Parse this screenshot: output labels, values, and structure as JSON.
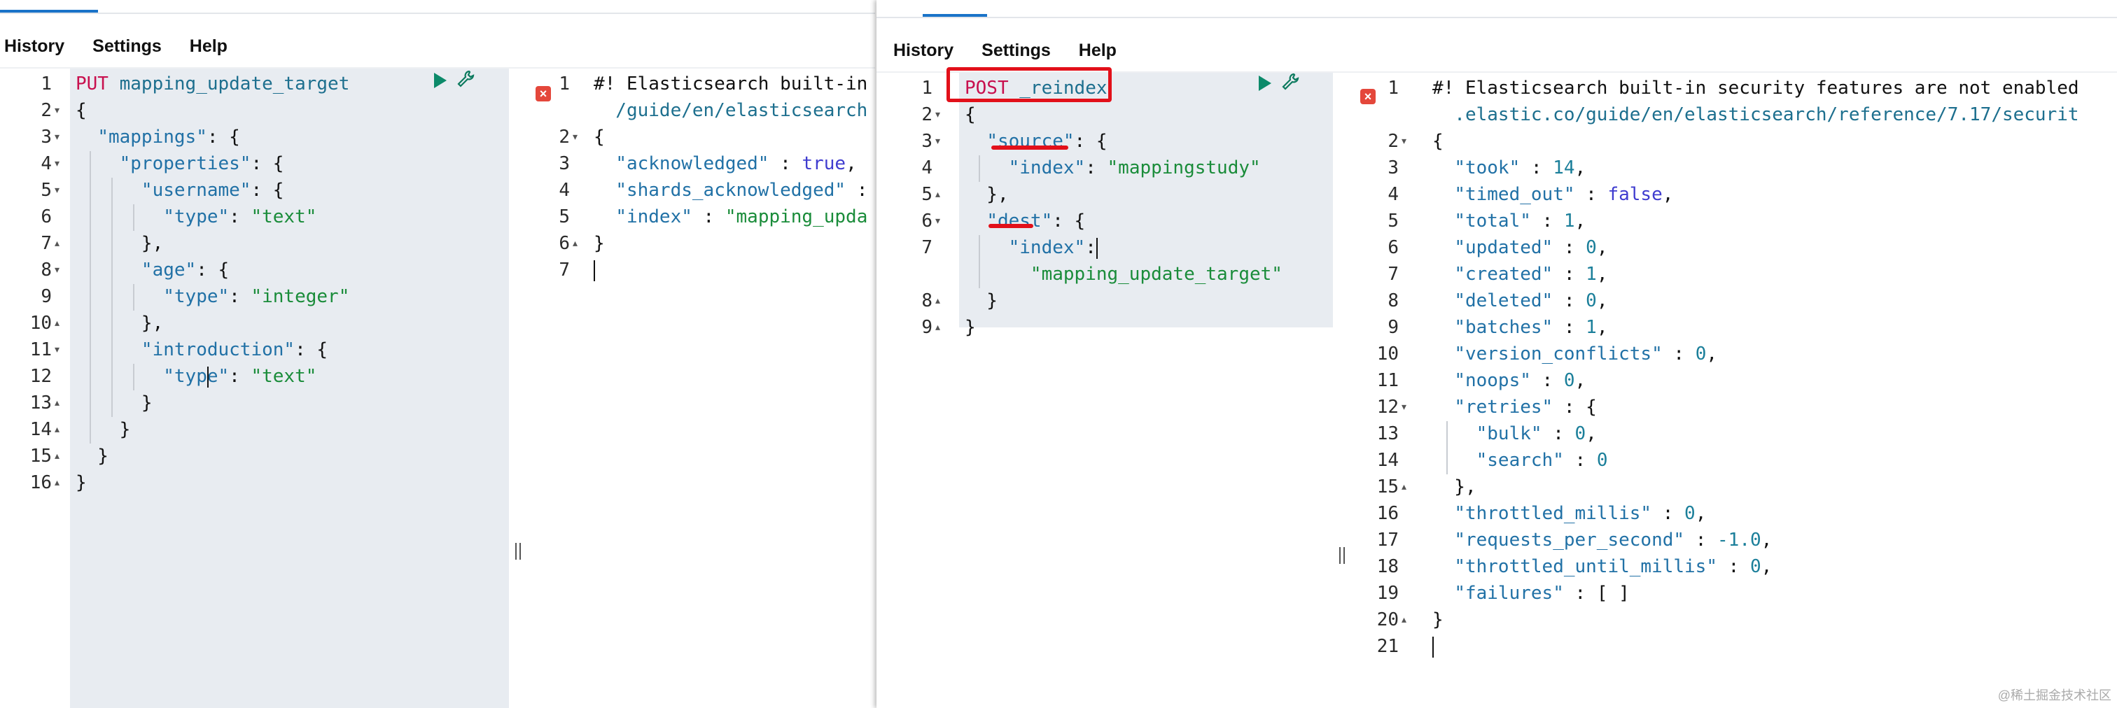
{
  "left_console": {
    "menu": [
      "History",
      "Settings",
      "Help"
    ],
    "request_lines": [
      [
        {
          "t": "PUT",
          "c": "m"
        },
        {
          "t": " mapping_update_target",
          "c": "p"
        }
      ],
      [
        {
          "t": "{",
          "c": "c"
        }
      ],
      [
        {
          "t": "  ",
          "c": "c"
        },
        {
          "t": "\"mappings\"",
          "c": "k"
        },
        {
          "t": ": {",
          "c": "c"
        }
      ],
      [
        {
          "t": "    ",
          "c": "c"
        },
        {
          "t": "\"properties\"",
          "c": "k"
        },
        {
          "t": ": {",
          "c": "c"
        }
      ],
      [
        {
          "t": "      ",
          "c": "c"
        },
        {
          "t": "\"username\"",
          "c": "k"
        },
        {
          "t": ": {",
          "c": "c"
        }
      ],
      [
        {
          "t": "        ",
          "c": "c"
        },
        {
          "t": "\"type\"",
          "c": "k"
        },
        {
          "t": ": ",
          "c": "c"
        },
        {
          "t": "\"text\"",
          "c": "s"
        }
      ],
      [
        {
          "t": "      },",
          "c": "c"
        }
      ],
      [
        {
          "t": "      ",
          "c": "c"
        },
        {
          "t": "\"age\"",
          "c": "k"
        },
        {
          "t": ": {",
          "c": "c"
        }
      ],
      [
        {
          "t": "        ",
          "c": "c"
        },
        {
          "t": "\"type\"",
          "c": "k"
        },
        {
          "t": ": ",
          "c": "c"
        },
        {
          "t": "\"integer\"",
          "c": "s"
        }
      ],
      [
        {
          "t": "      },",
          "c": "c"
        }
      ],
      [
        {
          "t": "      ",
          "c": "c"
        },
        {
          "t": "\"introduction\"",
          "c": "k"
        },
        {
          "t": ": {",
          "c": "c"
        }
      ],
      [
        {
          "t": "        ",
          "c": "c"
        },
        {
          "t": "\"type\"",
          "c": "k"
        },
        {
          "t": ": ",
          "c": "c"
        },
        {
          "t": "\"text\"",
          "c": "s"
        }
      ],
      [
        {
          "t": "      }",
          "c": "c"
        }
      ],
      [
        {
          "t": "    }",
          "c": "c"
        }
      ],
      [
        {
          "t": "  }",
          "c": "c"
        }
      ],
      [
        {
          "t": "}",
          "c": "c"
        }
      ]
    ],
    "response_lines": [
      [
        {
          "t": "#! Elasticsearch built-in",
          "c": "c"
        }
      ],
      [
        {
          "t": "  /guide/en/elasticsearch",
          "c": "p"
        }
      ],
      [
        {
          "t": "{",
          "c": "c"
        }
      ],
      [
        {
          "t": "  ",
          "c": "c"
        },
        {
          "t": "\"acknowledged\"",
          "c": "k"
        },
        {
          "t": " : ",
          "c": "c"
        },
        {
          "t": "true",
          "c": "b"
        },
        {
          "t": ",",
          "c": "c"
        }
      ],
      [
        {
          "t": "  ",
          "c": "c"
        },
        {
          "t": "\"shards_acknowledged\"",
          "c": "k"
        },
        {
          "t": " :",
          "c": "c"
        }
      ],
      [
        {
          "t": "  ",
          "c": "c"
        },
        {
          "t": "\"index\"",
          "c": "k"
        },
        {
          "t": " : ",
          "c": "c"
        },
        {
          "t": "\"mapping_upda",
          "c": "s"
        }
      ],
      [
        {
          "t": "}",
          "c": "c"
        }
      ],
      [
        {
          "t": "",
          "c": "c"
        }
      ]
    ],
    "response_line_numbers": [
      "1",
      "",
      "2",
      "3",
      "4",
      "5",
      "6",
      "7"
    ]
  },
  "right_console": {
    "menu": [
      "History",
      "Settings",
      "Help"
    ],
    "request_lines": [
      [
        {
          "t": "POST",
          "c": "m"
        },
        {
          "t": " _reindex",
          "c": "p"
        }
      ],
      [
        {
          "t": "{",
          "c": "c"
        }
      ],
      [
        {
          "t": "  ",
          "c": "c"
        },
        {
          "t": "\"source\"",
          "c": "k"
        },
        {
          "t": ": {",
          "c": "c"
        }
      ],
      [
        {
          "t": "    ",
          "c": "c"
        },
        {
          "t": "\"index\"",
          "c": "k"
        },
        {
          "t": ": ",
          "c": "c"
        },
        {
          "t": "\"mappingstudy\"",
          "c": "s"
        }
      ],
      [
        {
          "t": "  },",
          "c": "c"
        }
      ],
      [
        {
          "t": "  ",
          "c": "c"
        },
        {
          "t": "\"dest\"",
          "c": "k"
        },
        {
          "t": ": {",
          "c": "c"
        }
      ],
      [
        {
          "t": "    ",
          "c": "c"
        },
        {
          "t": "\"index\"",
          "c": "k"
        },
        {
          "t": ":",
          "c": "c"
        }
      ],
      [
        {
          "t": "      ",
          "c": "c"
        },
        {
          "t": "\"mapping_update_target\"",
          "c": "s"
        }
      ],
      [
        {
          "t": "  }",
          "c": "c"
        }
      ],
      [
        {
          "t": "}",
          "c": "c"
        }
      ]
    ],
    "request_line_numbers": [
      "1",
      "2",
      "3",
      "4",
      "5",
      "6",
      "7",
      "",
      "8",
      "9"
    ],
    "response_lines": [
      [
        {
          "t": "#! Elasticsearch built-in security features are not enabled",
          "c": "c"
        }
      ],
      [
        {
          "t": "  .elastic.co/guide/en/elasticsearch/reference/7.17/securit",
          "c": "p"
        }
      ],
      [
        {
          "t": "{",
          "c": "c"
        }
      ],
      [
        {
          "t": "  ",
          "c": "c"
        },
        {
          "t": "\"took\"",
          "c": "k"
        },
        {
          "t": " : ",
          "c": "c"
        },
        {
          "t": "14",
          "c": "n"
        },
        {
          "t": ",",
          "c": "c"
        }
      ],
      [
        {
          "t": "  ",
          "c": "c"
        },
        {
          "t": "\"timed_out\"",
          "c": "k"
        },
        {
          "t": " : ",
          "c": "c"
        },
        {
          "t": "false",
          "c": "b"
        },
        {
          "t": ",",
          "c": "c"
        }
      ],
      [
        {
          "t": "  ",
          "c": "c"
        },
        {
          "t": "\"total\"",
          "c": "k"
        },
        {
          "t": " : ",
          "c": "c"
        },
        {
          "t": "1",
          "c": "n"
        },
        {
          "t": ",",
          "c": "c"
        }
      ],
      [
        {
          "t": "  ",
          "c": "c"
        },
        {
          "t": "\"updated\"",
          "c": "k"
        },
        {
          "t": " : ",
          "c": "c"
        },
        {
          "t": "0",
          "c": "n"
        },
        {
          "t": ",",
          "c": "c"
        }
      ],
      [
        {
          "t": "  ",
          "c": "c"
        },
        {
          "t": "\"created\"",
          "c": "k"
        },
        {
          "t": " : ",
          "c": "c"
        },
        {
          "t": "1",
          "c": "n"
        },
        {
          "t": ",",
          "c": "c"
        }
      ],
      [
        {
          "t": "  ",
          "c": "c"
        },
        {
          "t": "\"deleted\"",
          "c": "k"
        },
        {
          "t": " : ",
          "c": "c"
        },
        {
          "t": "0",
          "c": "n"
        },
        {
          "t": ",",
          "c": "c"
        }
      ],
      [
        {
          "t": "  ",
          "c": "c"
        },
        {
          "t": "\"batches\"",
          "c": "k"
        },
        {
          "t": " : ",
          "c": "c"
        },
        {
          "t": "1",
          "c": "n"
        },
        {
          "t": ",",
          "c": "c"
        }
      ],
      [
        {
          "t": "  ",
          "c": "c"
        },
        {
          "t": "\"version_conflicts\"",
          "c": "k"
        },
        {
          "t": " : ",
          "c": "c"
        },
        {
          "t": "0",
          "c": "n"
        },
        {
          "t": ",",
          "c": "c"
        }
      ],
      [
        {
          "t": "  ",
          "c": "c"
        },
        {
          "t": "\"noops\"",
          "c": "k"
        },
        {
          "t": " : ",
          "c": "c"
        },
        {
          "t": "0",
          "c": "n"
        },
        {
          "t": ",",
          "c": "c"
        }
      ],
      [
        {
          "t": "  ",
          "c": "c"
        },
        {
          "t": "\"retries\"",
          "c": "k"
        },
        {
          "t": " : {",
          "c": "c"
        }
      ],
      [
        {
          "t": "    ",
          "c": "c"
        },
        {
          "t": "\"bulk\"",
          "c": "k"
        },
        {
          "t": " : ",
          "c": "c"
        },
        {
          "t": "0",
          "c": "n"
        },
        {
          "t": ",",
          "c": "c"
        }
      ],
      [
        {
          "t": "    ",
          "c": "c"
        },
        {
          "t": "\"search\"",
          "c": "k"
        },
        {
          "t": " : ",
          "c": "c"
        },
        {
          "t": "0",
          "c": "n"
        }
      ],
      [
        {
          "t": "  },",
          "c": "c"
        }
      ],
      [
        {
          "t": "  ",
          "c": "c"
        },
        {
          "t": "\"throttled_millis\"",
          "c": "k"
        },
        {
          "t": " : ",
          "c": "c"
        },
        {
          "t": "0",
          "c": "n"
        },
        {
          "t": ",",
          "c": "c"
        }
      ],
      [
        {
          "t": "  ",
          "c": "c"
        },
        {
          "t": "\"requests_per_second\"",
          "c": "k"
        },
        {
          "t": " : ",
          "c": "c"
        },
        {
          "t": "-1.0",
          "c": "n"
        },
        {
          "t": ",",
          "c": "c"
        }
      ],
      [
        {
          "t": "  ",
          "c": "c"
        },
        {
          "t": "\"throttled_until_millis\"",
          "c": "k"
        },
        {
          "t": " : ",
          "c": "c"
        },
        {
          "t": "0",
          "c": "n"
        },
        {
          "t": ",",
          "c": "c"
        }
      ],
      [
        {
          "t": "  ",
          "c": "c"
        },
        {
          "t": "\"failures\"",
          "c": "k"
        },
        {
          "t": " : [ ]",
          "c": "c"
        }
      ],
      [
        {
          "t": "}",
          "c": "c"
        }
      ],
      [
        {
          "t": "",
          "c": "c"
        }
      ]
    ],
    "response_line_numbers": [
      "1",
      "",
      "2",
      "3",
      "4",
      "5",
      "6",
      "7",
      "8",
      "9",
      "10",
      "11",
      "12",
      "13",
      "14",
      "15",
      "16",
      "17",
      "18",
      "19",
      "20",
      "21"
    ]
  },
  "watermark": "@稀土掘金技术社区",
  "colors": {
    "accent": "#1a73c8",
    "annotation": "#e2101a",
    "method": "#c8104e",
    "key": "#2171a6",
    "string": "#1a8c3a"
  }
}
